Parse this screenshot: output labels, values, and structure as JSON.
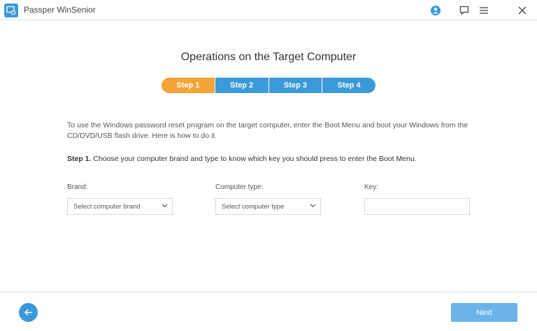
{
  "app": {
    "title": "Passper WinSenior"
  },
  "icons": {
    "logo": "passper-logo-icon",
    "account": "account-icon",
    "feedback": "feedback-icon",
    "menu": "menu-icon",
    "close": "close-icon",
    "back": "back-arrow-icon",
    "dropdown": "chevron-down-icon"
  },
  "colors": {
    "accent": "#3a9ad9",
    "active_step": "#f4a336",
    "next_button": "#6ab4ea"
  },
  "page": {
    "title": "Operations on the Target Computer",
    "steps": [
      {
        "label": "Step 1",
        "active": true
      },
      {
        "label": "Step 2",
        "active": false
      },
      {
        "label": "Step 3",
        "active": false
      },
      {
        "label": "Step 4",
        "active": false
      }
    ],
    "intro": "To use the Windows password reset program on the target computer, enter the Boot Menu and boot your Windows from the CD/DVD/USB flash drive. Here is how to do it.",
    "step1_heading": "Step 1.",
    "step1_text": " Choose your computer brand and type to know which key you should press to enter the Boot Menu."
  },
  "form": {
    "brand_label": "Brand:",
    "brand_value": "Select computer brand",
    "type_label": "Computer type:",
    "type_value": "Select computer type",
    "key_label": "Key:",
    "key_value": ""
  },
  "footer": {
    "next_label": "Next"
  }
}
